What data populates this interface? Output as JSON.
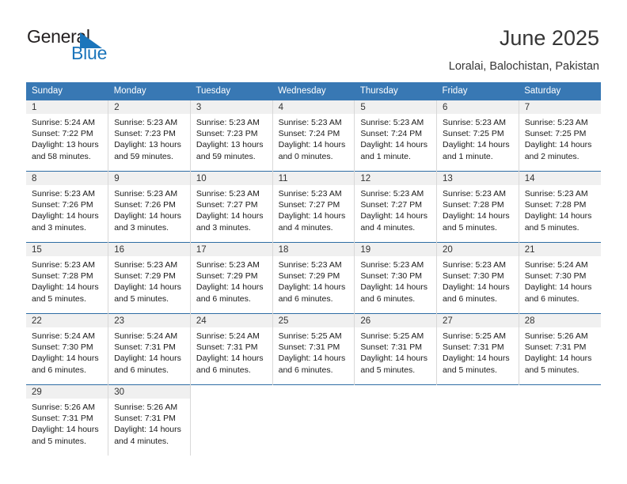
{
  "brand": {
    "name_top": "General",
    "name_bottom": "Blue",
    "mark_icon": "blue-triangle-flag-icon",
    "accent_color": "#1b75bb"
  },
  "header": {
    "title": "June 2025",
    "location": "Loralai, Balochistan, Pakistan"
  },
  "colors": {
    "header_row_bg": "#3878b4",
    "header_row_text": "#ffffff",
    "daynum_bg": "#f0f0f0",
    "cell_border": "#2e6da4",
    "column_divider": "#d8d8d8"
  },
  "calendar": {
    "weekday_headers": [
      "Sunday",
      "Monday",
      "Tuesday",
      "Wednesday",
      "Thursday",
      "Friday",
      "Saturday"
    ],
    "weeks": [
      [
        {
          "day": "1",
          "sunrise": "Sunrise: 5:24 AM",
          "sunset": "Sunset: 7:22 PM",
          "daylight": "Daylight: 13 hours and 58 minutes."
        },
        {
          "day": "2",
          "sunrise": "Sunrise: 5:23 AM",
          "sunset": "Sunset: 7:23 PM",
          "daylight": "Daylight: 13 hours and 59 minutes."
        },
        {
          "day": "3",
          "sunrise": "Sunrise: 5:23 AM",
          "sunset": "Sunset: 7:23 PM",
          "daylight": "Daylight: 13 hours and 59 minutes."
        },
        {
          "day": "4",
          "sunrise": "Sunrise: 5:23 AM",
          "sunset": "Sunset: 7:24 PM",
          "daylight": "Daylight: 14 hours and 0 minutes."
        },
        {
          "day": "5",
          "sunrise": "Sunrise: 5:23 AM",
          "sunset": "Sunset: 7:24 PM",
          "daylight": "Daylight: 14 hours and 1 minute."
        },
        {
          "day": "6",
          "sunrise": "Sunrise: 5:23 AM",
          "sunset": "Sunset: 7:25 PM",
          "daylight": "Daylight: 14 hours and 1 minute."
        },
        {
          "day": "7",
          "sunrise": "Sunrise: 5:23 AM",
          "sunset": "Sunset: 7:25 PM",
          "daylight": "Daylight: 14 hours and 2 minutes."
        }
      ],
      [
        {
          "day": "8",
          "sunrise": "Sunrise: 5:23 AM",
          "sunset": "Sunset: 7:26 PM",
          "daylight": "Daylight: 14 hours and 3 minutes."
        },
        {
          "day": "9",
          "sunrise": "Sunrise: 5:23 AM",
          "sunset": "Sunset: 7:26 PM",
          "daylight": "Daylight: 14 hours and 3 minutes."
        },
        {
          "day": "10",
          "sunrise": "Sunrise: 5:23 AM",
          "sunset": "Sunset: 7:27 PM",
          "daylight": "Daylight: 14 hours and 3 minutes."
        },
        {
          "day": "11",
          "sunrise": "Sunrise: 5:23 AM",
          "sunset": "Sunset: 7:27 PM",
          "daylight": "Daylight: 14 hours and 4 minutes."
        },
        {
          "day": "12",
          "sunrise": "Sunrise: 5:23 AM",
          "sunset": "Sunset: 7:27 PM",
          "daylight": "Daylight: 14 hours and 4 minutes."
        },
        {
          "day": "13",
          "sunrise": "Sunrise: 5:23 AM",
          "sunset": "Sunset: 7:28 PM",
          "daylight": "Daylight: 14 hours and 5 minutes."
        },
        {
          "day": "14",
          "sunrise": "Sunrise: 5:23 AM",
          "sunset": "Sunset: 7:28 PM",
          "daylight": "Daylight: 14 hours and 5 minutes."
        }
      ],
      [
        {
          "day": "15",
          "sunrise": "Sunrise: 5:23 AM",
          "sunset": "Sunset: 7:28 PM",
          "daylight": "Daylight: 14 hours and 5 minutes."
        },
        {
          "day": "16",
          "sunrise": "Sunrise: 5:23 AM",
          "sunset": "Sunset: 7:29 PM",
          "daylight": "Daylight: 14 hours and 5 minutes."
        },
        {
          "day": "17",
          "sunrise": "Sunrise: 5:23 AM",
          "sunset": "Sunset: 7:29 PM",
          "daylight": "Daylight: 14 hours and 6 minutes."
        },
        {
          "day": "18",
          "sunrise": "Sunrise: 5:23 AM",
          "sunset": "Sunset: 7:29 PM",
          "daylight": "Daylight: 14 hours and 6 minutes."
        },
        {
          "day": "19",
          "sunrise": "Sunrise: 5:23 AM",
          "sunset": "Sunset: 7:30 PM",
          "daylight": "Daylight: 14 hours and 6 minutes."
        },
        {
          "day": "20",
          "sunrise": "Sunrise: 5:23 AM",
          "sunset": "Sunset: 7:30 PM",
          "daylight": "Daylight: 14 hours and 6 minutes."
        },
        {
          "day": "21",
          "sunrise": "Sunrise: 5:24 AM",
          "sunset": "Sunset: 7:30 PM",
          "daylight": "Daylight: 14 hours and 6 minutes."
        }
      ],
      [
        {
          "day": "22",
          "sunrise": "Sunrise: 5:24 AM",
          "sunset": "Sunset: 7:30 PM",
          "daylight": "Daylight: 14 hours and 6 minutes."
        },
        {
          "day": "23",
          "sunrise": "Sunrise: 5:24 AM",
          "sunset": "Sunset: 7:31 PM",
          "daylight": "Daylight: 14 hours and 6 minutes."
        },
        {
          "day": "24",
          "sunrise": "Sunrise: 5:24 AM",
          "sunset": "Sunset: 7:31 PM",
          "daylight": "Daylight: 14 hours and 6 minutes."
        },
        {
          "day": "25",
          "sunrise": "Sunrise: 5:25 AM",
          "sunset": "Sunset: 7:31 PM",
          "daylight": "Daylight: 14 hours and 6 minutes."
        },
        {
          "day": "26",
          "sunrise": "Sunrise: 5:25 AM",
          "sunset": "Sunset: 7:31 PM",
          "daylight": "Daylight: 14 hours and 5 minutes."
        },
        {
          "day": "27",
          "sunrise": "Sunrise: 5:25 AM",
          "sunset": "Sunset: 7:31 PM",
          "daylight": "Daylight: 14 hours and 5 minutes."
        },
        {
          "day": "28",
          "sunrise": "Sunrise: 5:26 AM",
          "sunset": "Sunset: 7:31 PM",
          "daylight": "Daylight: 14 hours and 5 minutes."
        }
      ],
      [
        {
          "day": "29",
          "sunrise": "Sunrise: 5:26 AM",
          "sunset": "Sunset: 7:31 PM",
          "daylight": "Daylight: 14 hours and 5 minutes."
        },
        {
          "day": "30",
          "sunrise": "Sunrise: 5:26 AM",
          "sunset": "Sunset: 7:31 PM",
          "daylight": "Daylight: 14 hours and 4 minutes."
        },
        null,
        null,
        null,
        null,
        null
      ]
    ]
  }
}
